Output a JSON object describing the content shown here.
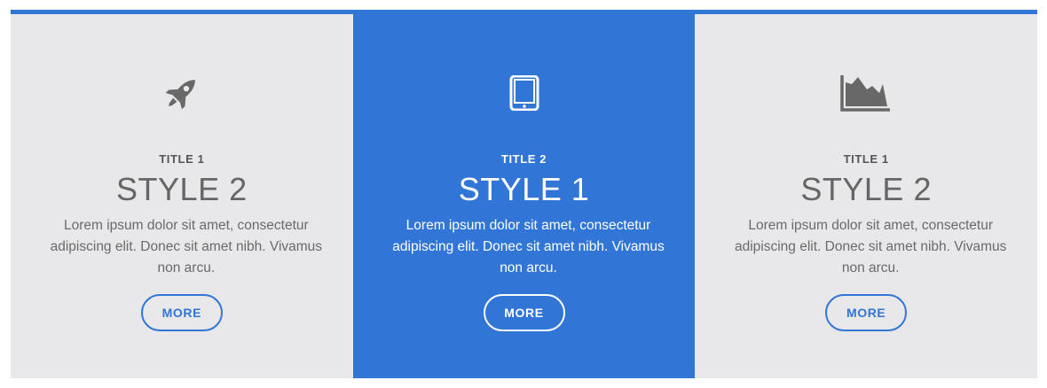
{
  "colors": {
    "accent": "#3176d6",
    "card_light_bg": "#e8e7e9",
    "icon_gray": "#686868"
  },
  "cards": [
    {
      "style": "light",
      "icon": "rocket-icon",
      "kicker": "TITLE 1",
      "heading": "STYLE 2",
      "body": "Lorem ipsum dolor sit amet, consectetur adipiscing elit. Donec sit amet nibh. Vivamus non arcu.",
      "button": "MORE"
    },
    {
      "style": "dark",
      "icon": "tablet-icon",
      "kicker": "TITLE 2",
      "heading": "STYLE 1",
      "body": "Lorem ipsum dolor sit amet, consectetur adipiscing elit. Donec sit amet nibh. Vivamus non arcu.",
      "button": "MORE"
    },
    {
      "style": "light",
      "icon": "area-chart-icon",
      "kicker": "TITLE 1",
      "heading": "STYLE 2",
      "body": "Lorem ipsum dolor sit amet, consectetur adipiscing elit. Donec sit amet nibh. Vivamus non arcu.",
      "button": "MORE"
    }
  ]
}
